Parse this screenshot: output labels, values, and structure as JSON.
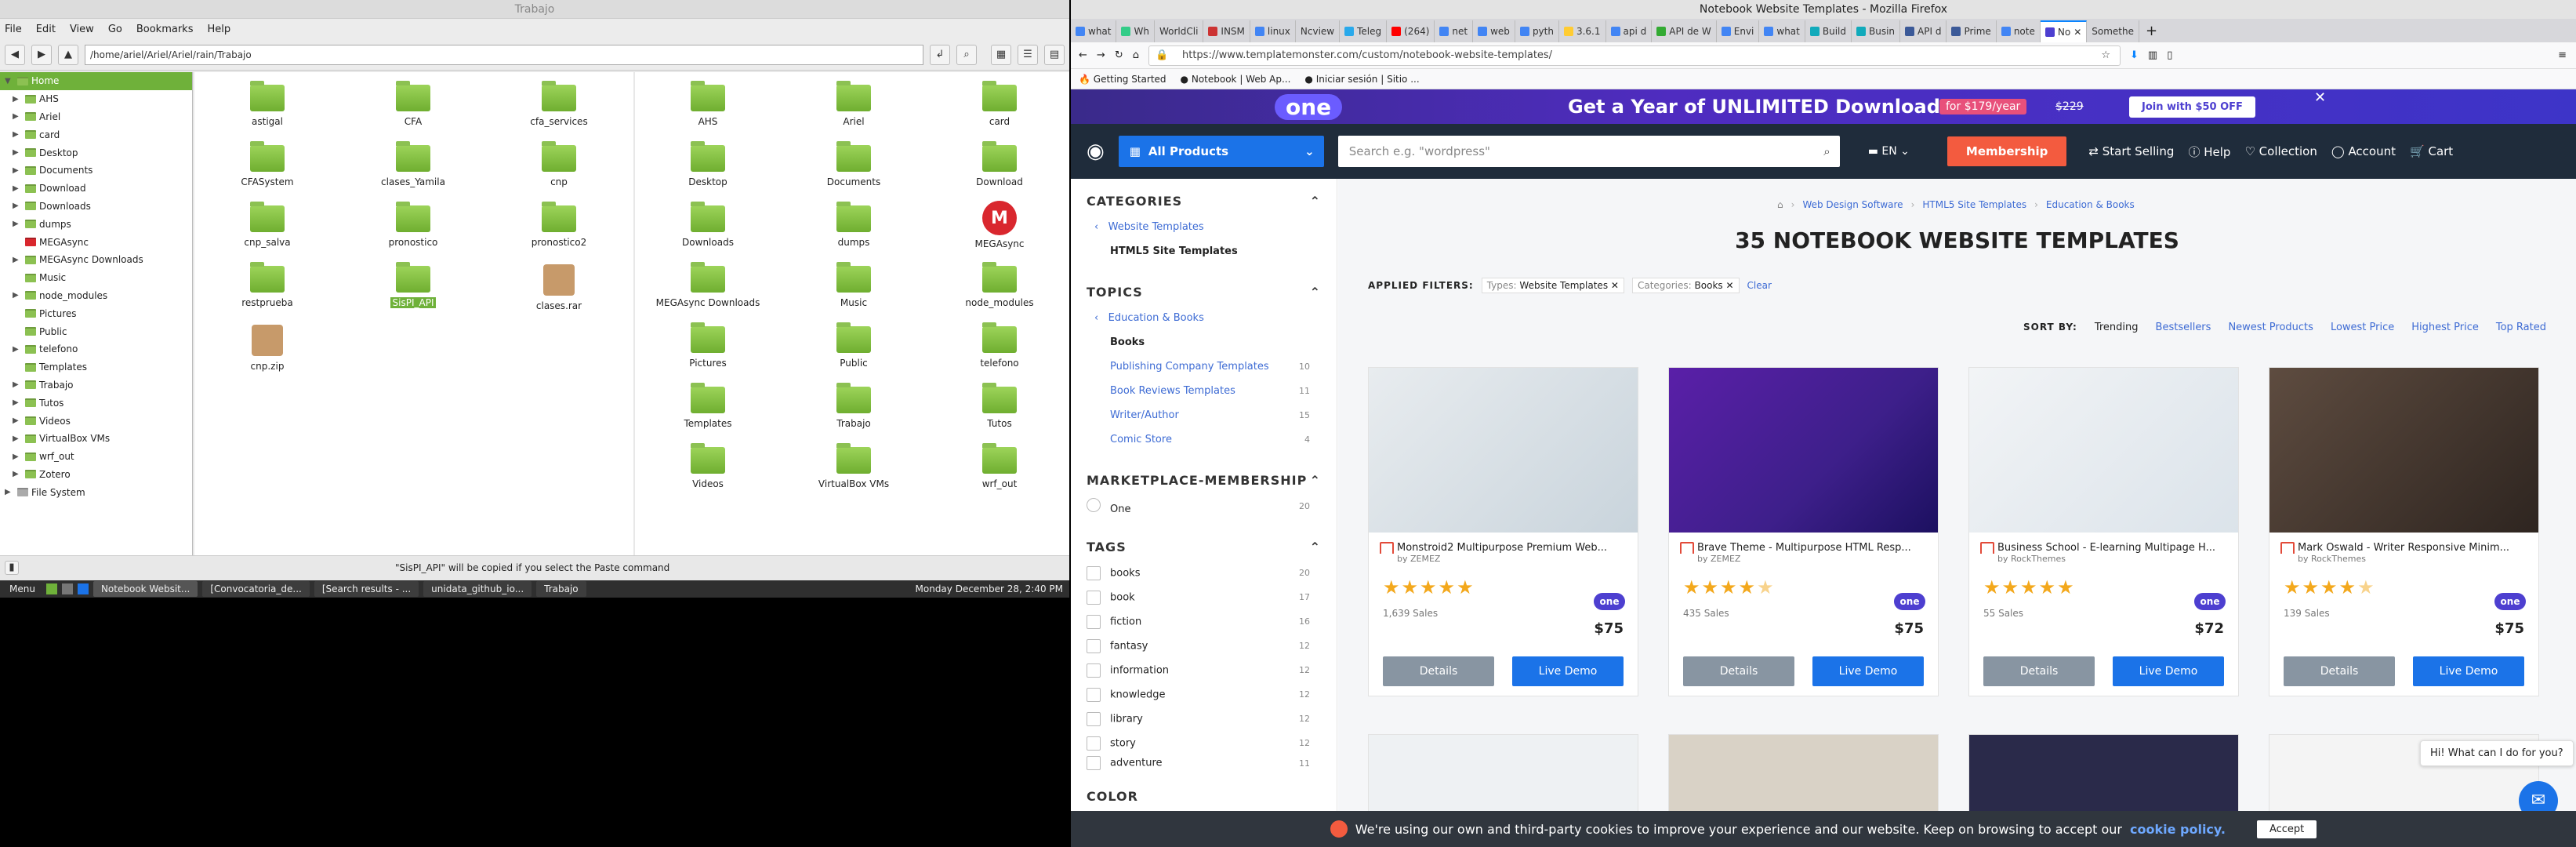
{
  "fm": {
    "title": "Trabajo",
    "menu": [
      "File",
      "Edit",
      "View",
      "Go",
      "Bookmarks",
      "Help"
    ],
    "path": "/home/ariel/Ariel/Ariel/rain/Trabajo",
    "tree": [
      "Home",
      "AHS",
      "Ariel",
      "card",
      "Desktop",
      "Documents",
      "Download",
      "Downloads",
      "dumps",
      "MEGAsync",
      "MEGAsync Downloads",
      "Music",
      "node_modules",
      "Pictures",
      "Public",
      "telefono",
      "Templates",
      "Trabajo",
      "Tutos",
      "Videos",
      "VirtualBox VMs",
      "wrf_out",
      "Zotero",
      "File System"
    ],
    "pane1": [
      "astigal",
      "CFA",
      "cfa_services",
      "CFASystem",
      "clases_Yamila",
      "cnp",
      "cnp_salva",
      "pronostico",
      "pronostico2",
      "restprueba",
      "SisPI_API",
      "clases.rar",
      "cnp.zip"
    ],
    "pane2": [
      "AHS",
      "Ariel",
      "card",
      "Desktop",
      "Documents",
      "Download",
      "Downloads",
      "dumps",
      "MEGAsync",
      "MEGAsync Downloads",
      "Music",
      "node_modules",
      "Pictures",
      "Public",
      "telefono",
      "Templates",
      "Trabajo",
      "Tutos",
      "Videos",
      "VirtualBox VMs",
      "wrf_out"
    ],
    "status": "\"SisPI_API\" will be copied if you select the Paste command"
  },
  "taskbar": {
    "menu": "Menu",
    "tasks": [
      "Notebook Websit...",
      "[Convocatoria_de...",
      "[Search results - ...",
      "unidata_github_io...",
      "Trabajo"
    ],
    "clock": "Monday December 28,  2:40 PM"
  },
  "ff": {
    "title": "Notebook Website Templates - Mozilla Firefox",
    "tabs": [
      "what",
      "Wh",
      "WorldCli",
      "INSM",
      "linux",
      "Ncview",
      "Teleg",
      "(264)",
      "net",
      "web",
      "pyth",
      "3.6.1",
      "api d",
      "API de W",
      "Envi",
      "what",
      "Build",
      "Busin",
      "API d",
      "Prime",
      "note",
      "No",
      "Somethe"
    ],
    "url": "https://www.templatemonster.com/custom/notebook-website-templates/",
    "bookmarks": [
      "Getting Started",
      "Notebook | Web Ap...",
      "Iniciar sesión | Sitio ..."
    ],
    "banner": {
      "logo": "one",
      "text": "Get a Year of UNLIMITED Downloads",
      "deal": "for $179/year",
      "old": "$229",
      "cta": "Join with $50 OFF"
    },
    "header": {
      "products": "All Products",
      "search_placeholder": "Search e.g. \"wordpress\"",
      "lang": "EN",
      "membership": "Membership",
      "start": "Start Selling",
      "help": "Help",
      "collection": "Collection",
      "account": "Account",
      "cart": "Cart"
    },
    "side": {
      "categories": "CATEGORIES",
      "cat_links": [
        "Website Templates",
        "HTML5 Site Templates"
      ],
      "topics": "TOPICS",
      "topic_parent": "Education & Books",
      "topic_current": "Books",
      "topic_items": [
        {
          "label": "Publishing Company Templates",
          "count": "10"
        },
        {
          "label": "Book Reviews Templates",
          "count": "11"
        },
        {
          "label": "Writer/Author",
          "count": "15"
        },
        {
          "label": "Comic Store",
          "count": "4"
        }
      ],
      "membership": "MARKETPLACE-MEMBERSHIP",
      "one": "One",
      "one_count": "20",
      "tags": "TAGS",
      "tag_items": [
        {
          "label": "books",
          "count": "20"
        },
        {
          "label": "book",
          "count": "17"
        },
        {
          "label": "fiction",
          "count": "16"
        },
        {
          "label": "fantasy",
          "count": "12"
        },
        {
          "label": "information",
          "count": "12"
        },
        {
          "label": "knowledge",
          "count": "12"
        },
        {
          "label": "library",
          "count": "12"
        },
        {
          "label": "story",
          "count": "12"
        },
        {
          "label": "adventure",
          "count": "11"
        }
      ],
      "color": "COLOR"
    },
    "main": {
      "breadcrumb": [
        "Web Design Software",
        "HTML5 Site Templates",
        "Education & Books"
      ],
      "heading": "35 NOTEBOOK WEBSITE TEMPLATES",
      "applied": "APPLIED FILTERS:",
      "filter1_key": "Types:",
      "filter1_val": "Website Templates",
      "filter2_key": "Categories:",
      "filter2_val": "Books",
      "clear": "Clear",
      "sortby": "SORT BY:",
      "sorts": [
        "Trending",
        "Bestsellers",
        "Newest Products",
        "Lowest Price",
        "Highest Price",
        "Top Rated"
      ],
      "cards": [
        {
          "title": "Monstroid2 Multipurpose Premium Web...",
          "by": "by ZEMEZ",
          "sales": "1,639 Sales",
          "price": "$75",
          "rating": 5
        },
        {
          "title": "Brave Theme - Multipurpose HTML Resp...",
          "by": "by ZEMEZ",
          "sales": "435 Sales",
          "price": "$75",
          "rating": 4.5
        },
        {
          "title": "Business School - E-learning Multipage H...",
          "by": "by RockThemes",
          "sales": "55 Sales",
          "price": "$72",
          "rating": 5
        },
        {
          "title": "Mark Oswald - Writer Responsive Minim...",
          "by": "by RockThemes",
          "sales": "139 Sales",
          "price": "$75",
          "rating": 4.5
        }
      ],
      "details": "Details",
      "live": "Live Demo",
      "one": "one"
    },
    "chat": "Hi! What can I do for you?",
    "cookie": {
      "text": "We're using our own and third-party cookies to improve your experience and our website. Keep on browsing to accept our",
      "link": "cookie policy.",
      "accept": "Accept"
    }
  }
}
